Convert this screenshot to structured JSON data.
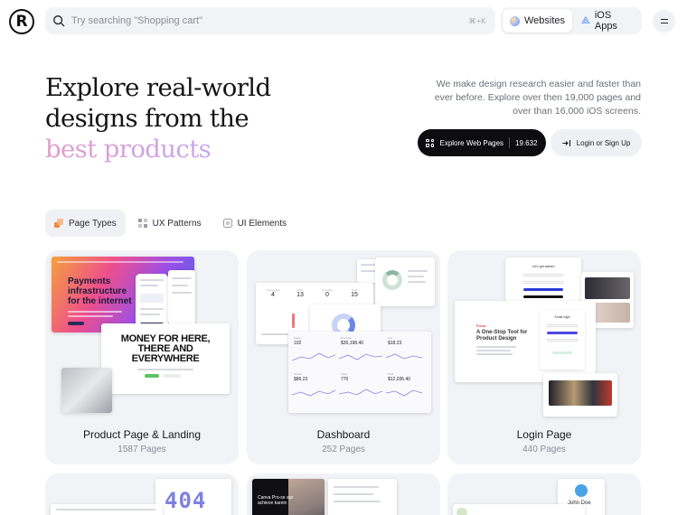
{
  "header": {
    "logo_text": "R",
    "search": {
      "placeholder": "Try searching \"Shopping cart\"",
      "shortcut": "⌘+K"
    },
    "platform_options": [
      {
        "label": "Websites",
        "icon": "globe-icon",
        "active": true
      },
      {
        "label": "iOS Apps",
        "icon": "apple-icon",
        "active": false
      }
    ],
    "menu_icon": "hamburger-icon"
  },
  "hero": {
    "title_line1": "Explore real-world",
    "title_line2": "designs from the",
    "title_highlight": "best products",
    "description": "We make design research easier and faster than ever before. Explore over then 19,000 pages and over than 16,000 iOS screens.",
    "explore_button": {
      "label": "Explore Web Pages",
      "count": "19.632"
    },
    "login_button": {
      "label": "Login or Sign Up"
    }
  },
  "tabs": [
    {
      "label": "Page Types",
      "icon": "page-types-icon",
      "active": true
    },
    {
      "label": "UX Patterns",
      "icon": "ux-patterns-icon",
      "active": false
    },
    {
      "label": "UI Elements",
      "icon": "ui-elements-icon",
      "active": false
    }
  ],
  "cards": [
    {
      "title": "Product Page & Landing",
      "count": "1587 Pages",
      "preview": {
        "hero_text": "Payments infrastructure for the internet",
        "hero_text_line1": "Payments",
        "hero_text_line2": "infrastructure",
        "hero_text_line3": "for the internet",
        "banner_line1": "MONEY FOR HERE,",
        "banner_line2": "THERE AND",
        "banner_line3": "EVERYWHERE"
      }
    },
    {
      "title": "Dashboard",
      "count": "252 Pages",
      "preview": {
        "stats": [
          "4",
          "13",
          "0",
          "15"
        ],
        "values": [
          "102",
          "$35,198.40",
          "$18.23",
          "$86.23",
          "770",
          "$12,036.40"
        ]
      }
    },
    {
      "title": "Login Page",
      "count": "440 Pages",
      "preview": {
        "brand": "Pixsa",
        "tagline_line1": "A One-Stop Tool for",
        "tagline_line2": "Product Design",
        "form_title": "Email login"
      }
    },
    {
      "preview": {
        "big_text": "404"
      }
    },
    {
      "preview": {
        "headline_line1": "Canva Pro-se aur",
        "headline_line2": "achieve karein"
      }
    },
    {
      "preview": {
        "name": "John Doe"
      }
    }
  ]
}
